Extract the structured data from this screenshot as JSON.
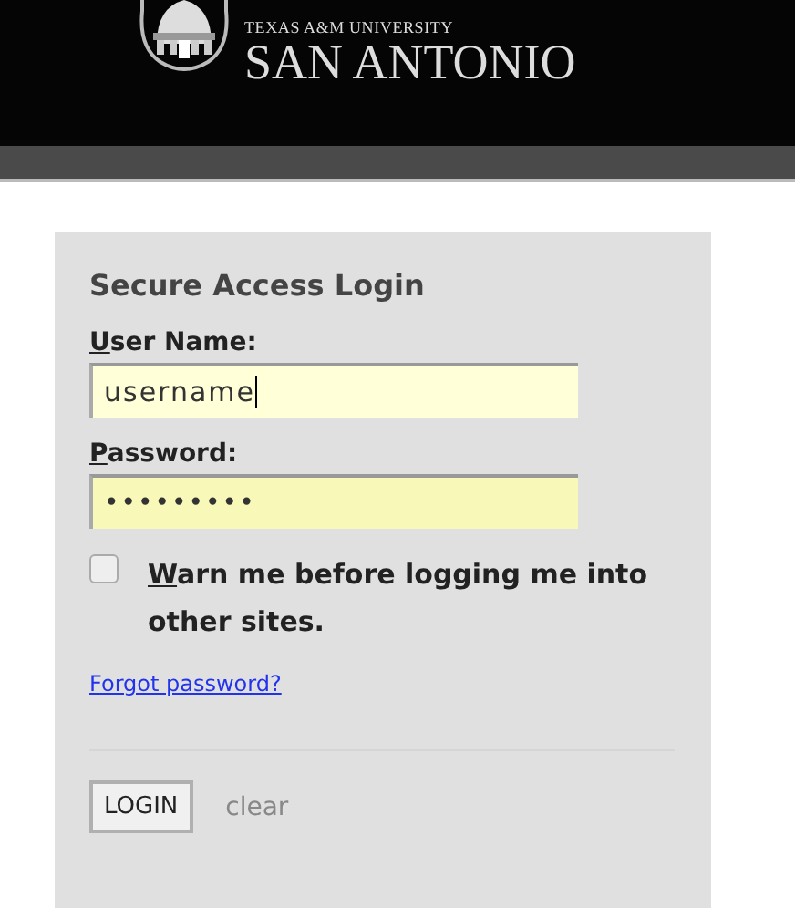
{
  "header": {
    "logo_small": "TEXAS A&M UNIVERSITY",
    "logo_large": "SAN ANTONIO"
  },
  "login": {
    "title": "Secure Access Login",
    "fields": [
      {
        "access_key": "U",
        "label_rest": "ser Name:",
        "value": "username",
        "kind": "text",
        "focused": true
      },
      {
        "access_key": "P",
        "label_rest": "assword:",
        "value": "•••••••••",
        "kind": "password",
        "focused": false
      }
    ],
    "warn": {
      "access_key": "W",
      "label_rest": "arn me before logging me into other sites.",
      "checked": false
    },
    "forgot_link": "Forgot password?",
    "login_button": "LOGIN",
    "clear_link": "clear"
  }
}
